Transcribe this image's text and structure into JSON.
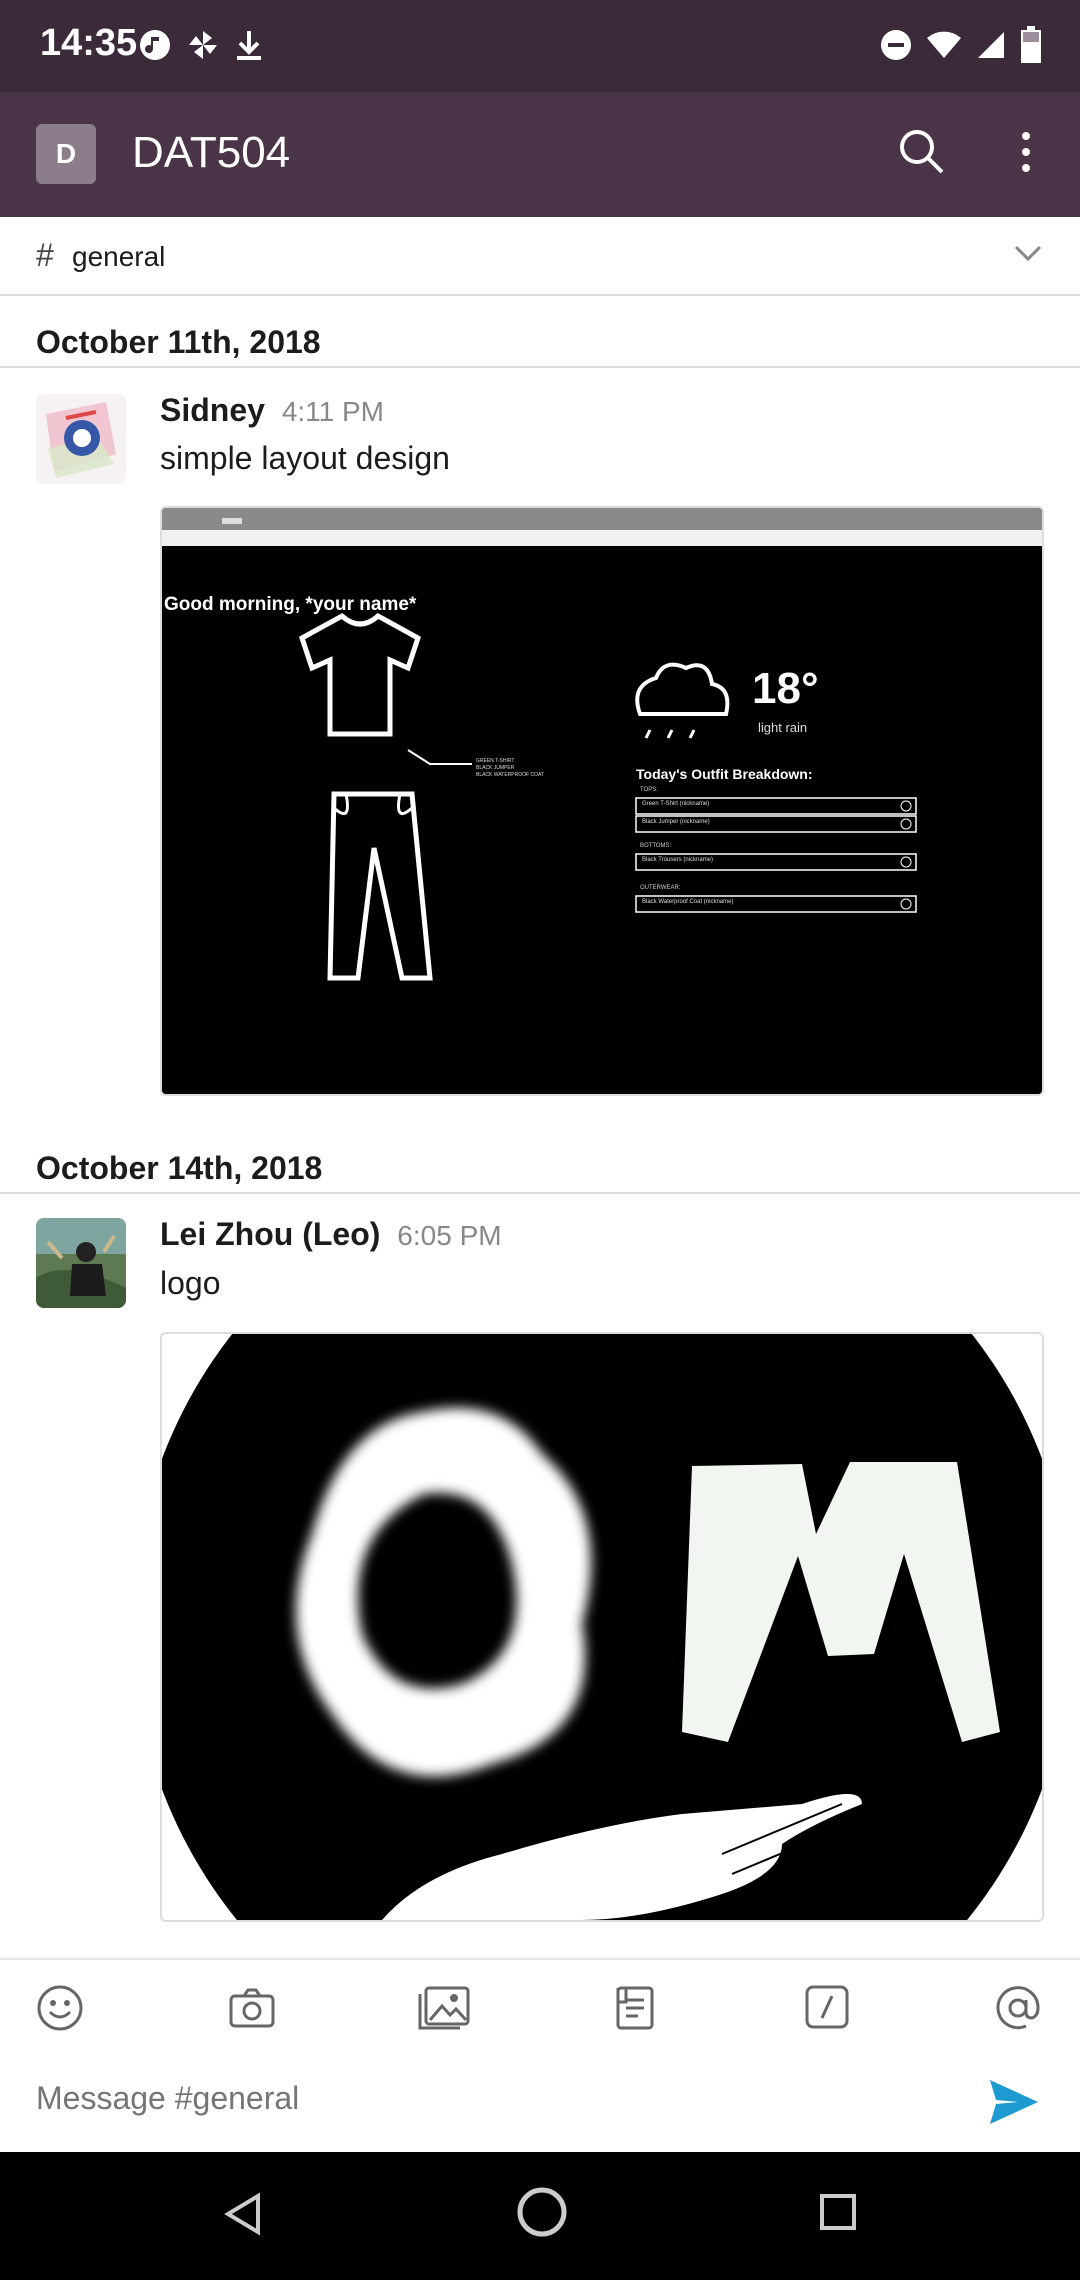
{
  "status_bar": {
    "time": "14:35",
    "icons": [
      "music-icon",
      "pinwheel-icon",
      "download-icon",
      "dnd-icon",
      "wifi-icon",
      "signal-icon",
      "battery-icon"
    ]
  },
  "app_bar": {
    "workspace_initial": "D",
    "workspace_name": "DAT504",
    "actions": [
      "search-icon",
      "more-vertical-icon"
    ]
  },
  "channel": {
    "hash": "#",
    "name": "general"
  },
  "messages": [
    {
      "date": "October 11th, 2018",
      "author": "Sidney",
      "time": "4:11 PM",
      "text": "simple layout design",
      "attachment": {
        "greeting": "Good morning, *your name*",
        "temp": "18°",
        "condition": "light rain",
        "breakdown_title": "Today's Outfit Breakdown:",
        "tops_label": "TOPS:",
        "bottoms_label": "BOTTOMS:",
        "outerwear_label": "OUTERWEAR:",
        "items": [
          "Green T-Shirt (nickname)",
          "Black Jumper (nickname)",
          "Black Trousers (nickname)",
          "Black Waterproof Coat (nickname)"
        ],
        "callout": [
          "GREEN T-SHIRT",
          "BLACK JUMPER",
          "BLACK WATERPROOF COAT"
        ]
      }
    },
    {
      "date": "October 14th, 2018",
      "author": "Lei Zhou (Leo)",
      "time": "6:05 PM",
      "text": "logo",
      "attachment": {}
    }
  ],
  "composer": {
    "icons": [
      "emoji-icon",
      "camera-icon",
      "gallery-icon",
      "file-icon",
      "slash-command-icon",
      "mention-icon"
    ],
    "placeholder": "Message #general"
  },
  "nav_bar": [
    "back-icon",
    "home-icon",
    "recents-icon"
  ],
  "colors": {
    "app_bar": "#4a3448",
    "status_bar": "#3a2a3a",
    "send": "#1d9bd1"
  }
}
